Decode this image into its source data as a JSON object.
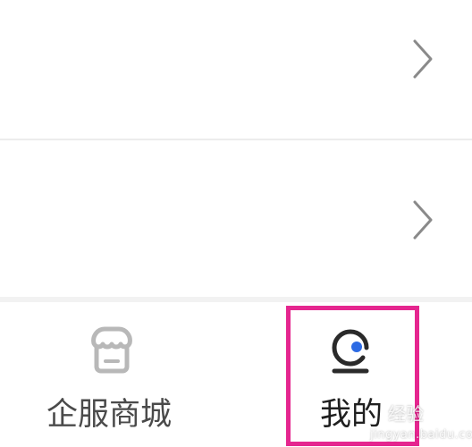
{
  "list": {
    "rows": [
      {
        "icon": "chevron-right-icon"
      },
      {
        "icon": "chevron-right-icon"
      }
    ]
  },
  "tabbar": {
    "tabs": [
      {
        "label": "企服商城",
        "icon": "store-icon",
        "selected": false
      },
      {
        "label": "我的",
        "icon": "profile-icon",
        "selected": true
      }
    ]
  },
  "watermark": {
    "top": "经验",
    "url": "jingyan.baidu.com"
  },
  "colors": {
    "highlight": "#e5268f",
    "accent": "#2d6be4",
    "icon_gray": "#b8b8b8",
    "icon_dark": "#2a2a2a"
  }
}
